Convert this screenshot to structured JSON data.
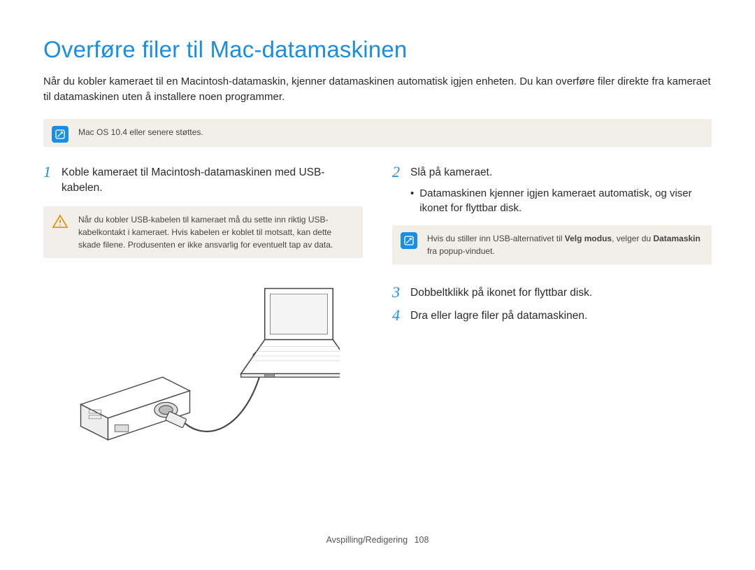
{
  "title": "Overføre filer til Mac-datamaskinen",
  "intro": "Når du kobler kameraet til en Macintosh-datamaskin, kjenner datamaskinen automatisk igjen enheten. Du kan overføre filer direkte fra kameraet til datamaskinen uten å installere noen programmer.",
  "note_top": "Mac OS 10.4 eller senere støttes.",
  "left": {
    "step1_num": "1",
    "step1_text": "Koble kameraet til Macintosh-datamaskinen med USB-kabelen.",
    "warn_text": "Når du kobler USB-kabelen til kameraet må du sette inn riktig USB-kabelkontakt i kameraet. Hvis kabelen er koblet til motsatt, kan dette skade filene. Produsenten er ikke ansvarlig for eventuelt tap av data."
  },
  "right": {
    "step2_num": "2",
    "step2_text": "Slå på kameraet.",
    "bullet1": "Datamaskinen kjenner igjen kameraet automatisk, og viser ikonet for flyttbar disk.",
    "note_text_pre": "Hvis du stiller inn USB-alternativet til ",
    "note_bold1": "Velg modus",
    "note_text_mid": ", velger du ",
    "note_bold2": "Datamaskin",
    "note_text_post": " fra popup-vinduet.",
    "step3_num": "3",
    "step3_text": "Dobbeltklikk på ikonet for flyttbar disk.",
    "step4_num": "4",
    "step4_text": "Dra eller lagre filer på datamaskinen."
  },
  "footer_label": "Avspilling/Redigering",
  "footer_page": "108"
}
